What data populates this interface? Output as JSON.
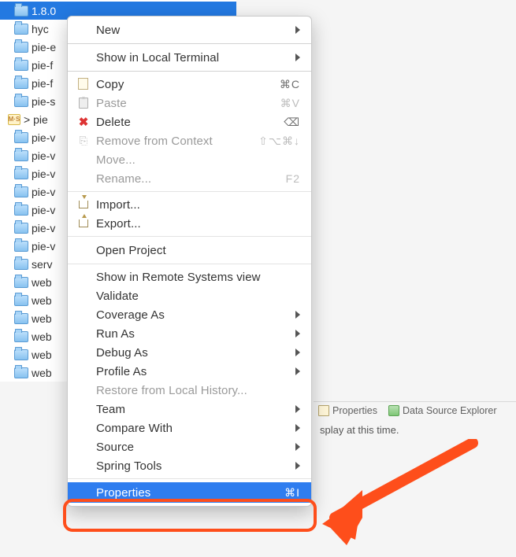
{
  "tree": {
    "items": [
      {
        "label": "1.8.0",
        "selected": true
      },
      {
        "label": "hyc"
      },
      {
        "label": "pie-e"
      },
      {
        "label": "pie-f"
      },
      {
        "label": "pie-f"
      },
      {
        "label": "pie-s"
      },
      {
        "label": "> pie",
        "modified": true
      },
      {
        "label": "pie-v"
      },
      {
        "label": "pie-v"
      },
      {
        "label": "pie-v"
      },
      {
        "label": "pie-v"
      },
      {
        "label": "pie-v"
      },
      {
        "label": "pie-v"
      },
      {
        "label": "pie-v"
      },
      {
        "label": "serv"
      },
      {
        "label": "web"
      },
      {
        "label": "web"
      },
      {
        "label": "web"
      },
      {
        "label": "web"
      },
      {
        "label": "web"
      },
      {
        "label": "web"
      }
    ]
  },
  "menu": {
    "new": "New",
    "show_terminal": "Show in Local Terminal",
    "copy": {
      "label": "Copy",
      "shortcut": "⌘C"
    },
    "paste": {
      "label": "Paste",
      "shortcut": "⌘V"
    },
    "delete": {
      "label": "Delete",
      "shortcut": "⌫"
    },
    "remove_ctx": {
      "label": "Remove from Context",
      "shortcut": "⇧⌥⌘↓"
    },
    "move": "Move...",
    "rename": {
      "label": "Rename...",
      "shortcut": "F2"
    },
    "import": "Import...",
    "export": "Export...",
    "open_project": "Open Project",
    "remote_view": "Show in Remote Systems view",
    "validate": "Validate",
    "coverage_as": "Coverage As",
    "run_as": "Run As",
    "debug_as": "Debug As",
    "profile_as": "Profile As",
    "restore_history": "Restore from Local History...",
    "team": "Team",
    "compare_with": "Compare With",
    "source": "Source",
    "spring_tools": "Spring Tools",
    "properties": {
      "label": "Properties",
      "shortcut": "⌘I"
    }
  },
  "bottom_panel": {
    "tab_properties": "Properties",
    "tab_dse": "Data Source Explorer",
    "message": "splay at this time."
  }
}
